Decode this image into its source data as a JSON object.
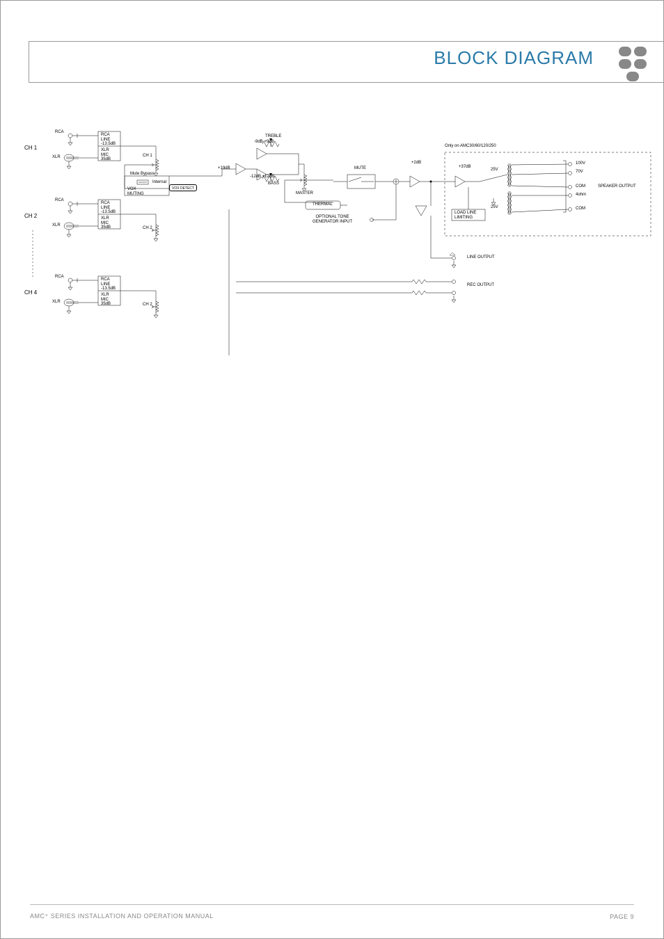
{
  "header": {
    "title": "BLOCK DIAGRAM"
  },
  "footer": {
    "left": "AMC⁺ SERIES INSTALLATION AND OPERATION MANUAL",
    "right": "PAGE 9"
  },
  "channels": {
    "ch1": {
      "label": "CH 1",
      "rca": "RCA",
      "xlr": "XLR"
    },
    "ch2": {
      "label": "CH 2",
      "rca": "RCA",
      "xlr": "XLR"
    },
    "ch4": {
      "label": "CH 4",
      "rca": "RCA",
      "xlr": "XLR"
    }
  },
  "gain_box": {
    "rca_line": "RCA\nLINE\n-13.5dB",
    "xlr_mic": "XLR\nMIC\n35dB"
  },
  "pots": {
    "ch1": "CH 1",
    "ch2": "CH 2",
    "ch2b": "CH 2"
  },
  "mute": {
    "bypass": "Mute Bypass",
    "internal": "Internal",
    "vox_muting": "VOX\nMUTING",
    "vox_detect": "VOX DETECT"
  },
  "stage": {
    "plus19": "+19dB",
    "treble": "TREBLE",
    "treble_range": "-9dB          +9dB",
    "bass": "BASS",
    "bass_range": "-12dB          +12dB",
    "master": "MASTER",
    "thermal": "THERMAL",
    "tone_in": "OPTIONAL TONE\nGENERATOR INPUT",
    "mute_label": "MUTE",
    "plus2": "+2dB",
    "plus37": "+37dB",
    "loadline": "LOAD LINE\nLIMITING"
  },
  "output_section": {
    "note": "Only on AMC30/60/120/250",
    "tap25a": "25V",
    "tap25b": "25V",
    "spk100": "100V",
    "spk70": "70V",
    "spkcom": "COM",
    "spk4": "4ohm",
    "spkcom2": "COM",
    "speaker_output": "SPEAKER OUTPUT"
  },
  "outputs": {
    "line": "LINE OUTPUT",
    "rec": "REC OUTPUT"
  }
}
